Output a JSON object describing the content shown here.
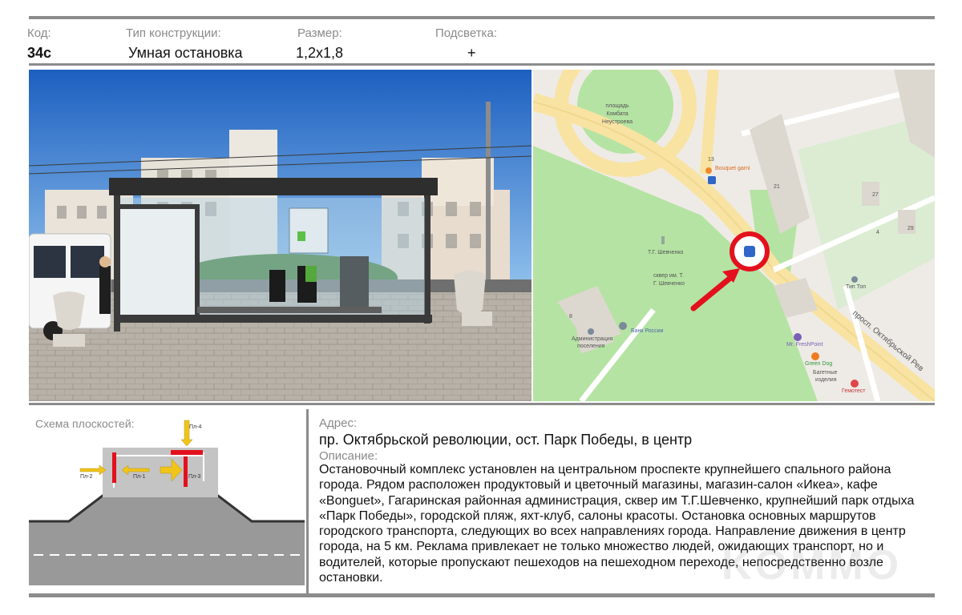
{
  "header": {
    "code_label": "Код:",
    "code_value": "34с",
    "type_label": "Тип конструкции:",
    "type_value": "Умная остановка",
    "size_label": "Размер:",
    "size_value": "1,2x1,8",
    "lighting_label": "Подсветка:",
    "lighting_value": "+"
  },
  "map": {
    "place_kombat": [
      "площадь",
      "Комбата",
      "Неустроева"
    ],
    "building_13": "13",
    "bouquet_label": "Bouquet garni",
    "building_21": "21",
    "building_27": "27",
    "building_29": "29",
    "building_4": "4",
    "monument_label": "Т.Г. Шевченко",
    "park_label": [
      "сквер им. Т.",
      "Г. Шевченко"
    ],
    "tip_top_label": "Тип Топ",
    "building_8": "8",
    "administration_label": [
      "Администрация",
      "поселения"
    ],
    "bank_label": "Банк России",
    "freshpoint_label": "Mr. FreshPoint",
    "greendog_label": "Green Dog",
    "bakery_label": [
      "Багетные",
      "изделия"
    ],
    "gemotest_label": "Гемотест",
    "street_label": "просп. Октябрьской Рев",
    "colors": {
      "marker_ring": "#e3101d",
      "arrow": "#e3101d",
      "park": "#b5e3a3",
      "road": "#f8e3a2"
    }
  },
  "schema": {
    "title": "Схема плоскостей:",
    "pl1": "Пл-1",
    "pl2": "Пл-2",
    "pl3": "Пл-3",
    "pl4": "Пл-4",
    "colors": {
      "panel": "#e3101d",
      "arrow": "#f0c419",
      "platform": "#c4c4c4",
      "road": "#999999"
    }
  },
  "address": {
    "label": "Адрес:",
    "value": "пр. Октябрьской революции, ост. Парк Победы, в центр"
  },
  "description": {
    "label": "Описание:",
    "text": "Остановочный комплекс установлен на центральном проспекте крупнейшего спального района города. Рядом  расположен продуктовый и цветочный магазины, магазин-салон «Икеа», кафе «Bonguet», Гагаринская районная администрация, сквер им Т.Г.Шевченко, крупнейший парк отдыха «Парк Победы», городской пляж, яхт-клуб, салоны красоты. Остановка основных маршрутов городского транспорта, следующих во всех направлениях города. Направление движения в центр города, на 5 км. Реклама привлекает не только множество людей, ожидающих транспорт, но и водителей, которые пропускают пешеходов на  пешеходном переходе,  непосредственно возле остановки."
  },
  "watermark": "KOMMO"
}
